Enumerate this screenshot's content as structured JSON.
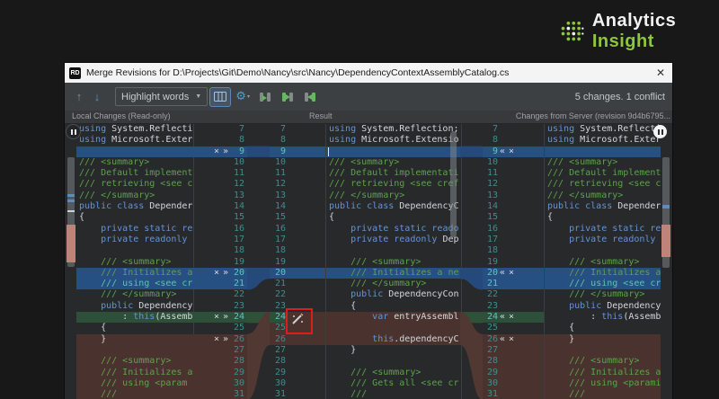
{
  "logo": {
    "brand_first": "Analytics ",
    "brand_second": "Insight"
  },
  "window": {
    "app_icon": "RD",
    "title": "Merge Revisions for D:\\Projects\\Git\\Demo\\Nancy\\src\\Nancy\\DependencyContextAssemblyCatalog.cs",
    "close_glyph": "✕"
  },
  "toolbar": {
    "prev_glyph": "↑",
    "next_glyph": "↓",
    "highlight_mode": "Highlight words",
    "caret_glyph": "▼",
    "gear_glyph": "⚙",
    "gear_caret_glyph": "▾",
    "status": "5 changes. 1 conflict"
  },
  "panes": {
    "headers": [
      "Local Changes (Read-only)",
      "Result",
      "Changes from Server (revision 9d4b6795..."
    ]
  },
  "colors": {
    "kw": "#6494d6",
    "cm": "#5ca349",
    "tx": "#d4d7da",
    "num": "#3e8e8e",
    "hlblue": "#264f82",
    "hlgreen": "#2e4f3a",
    "hlbrown": "#4a332e",
    "bandblue": "#24497a",
    "bandgreen": "#2f5138",
    "bandbrown": "#523832",
    "red": "#e01b1b",
    "logogreen": "#8dc63f",
    "editorbg": "#27292b"
  },
  "editor": {
    "left": {
      "read_only": true,
      "icon_glyphs": [
        "×",
        "»"
      ],
      "lines": [
        {
          "n": 7,
          "seg": [
            [
              "k",
              "using "
            ],
            [
              "t",
              "System.Reflecti"
            ]
          ]
        },
        {
          "n": 8,
          "seg": [
            [
              "k",
              "using "
            ],
            [
              "t",
              "Microsoft.Exter"
            ]
          ]
        },
        {
          "n": 9,
          "hl": "blue",
          "act": true,
          "seg": []
        },
        {
          "n": 10,
          "seg": [
            [
              "c",
              "/// <summary>"
            ]
          ]
        },
        {
          "n": 11,
          "seg": [
            [
              "c",
              "/// Default implement"
            ]
          ]
        },
        {
          "n": 12,
          "seg": [
            [
              "c",
              "/// retrieving <see c"
            ]
          ]
        },
        {
          "n": 13,
          "seg": [
            [
              "c",
              "/// </summary>"
            ]
          ]
        },
        {
          "n": 14,
          "seg": [
            [
              "k",
              "public class "
            ],
            [
              "t",
              "Depender"
            ]
          ]
        },
        {
          "n": 15,
          "seg": [
            [
              "t",
              "{"
            ]
          ]
        },
        {
          "n": 16,
          "seg": [
            [
              "t",
              "    "
            ],
            [
              "k",
              "private static re"
            ]
          ]
        },
        {
          "n": 17,
          "seg": [
            [
              "t",
              "    "
            ],
            [
              "k",
              "private readonly"
            ]
          ]
        },
        {
          "n": 18,
          "seg": []
        },
        {
          "n": 19,
          "seg": [
            [
              "t",
              "    "
            ],
            [
              "c",
              "/// <summary>"
            ]
          ]
        },
        {
          "n": 20,
          "hl": "blue",
          "act": true,
          "seg": [
            [
              "t",
              "    "
            ],
            [
              "c",
              "/// Initializes a"
            ]
          ]
        },
        {
          "n": 21,
          "hl": "blue",
          "seg": [
            [
              "t",
              "    "
            ],
            [
              "hc",
              "/// using <see cr"
            ]
          ]
        },
        {
          "n": 22,
          "seg": [
            [
              "t",
              "    "
            ],
            [
              "c",
              "/// </summary>"
            ]
          ]
        },
        {
          "n": 23,
          "seg": [
            [
              "t",
              "    "
            ],
            [
              "k",
              "public "
            ],
            [
              "t",
              "Dependency"
            ]
          ]
        },
        {
          "n": 24,
          "hl": "green",
          "act": true,
          "seg": [
            [
              "t",
              "        : "
            ],
            [
              "k",
              "this"
            ],
            [
              "t",
              "(Assemb"
            ]
          ]
        },
        {
          "n": 25,
          "seg": [
            [
              "t",
              "    {"
            ]
          ]
        },
        {
          "n": 26,
          "hl": "brown",
          "act": true,
          "seg": [
            [
              "t",
              "    }"
            ]
          ]
        },
        {
          "n": 27,
          "hl": "brown",
          "seg": []
        },
        {
          "n": 28,
          "hl": "brown",
          "seg": [
            [
              "t",
              "    "
            ],
            [
              "c",
              "/// <summary>"
            ]
          ]
        },
        {
          "n": 29,
          "hl": "brown",
          "seg": [
            [
              "t",
              "    "
            ],
            [
              "c",
              "/// Initializes a"
            ]
          ]
        },
        {
          "n": 30,
          "hl": "brown",
          "seg": [
            [
              "t",
              "    "
            ],
            [
              "c",
              "/// using <param"
            ]
          ]
        },
        {
          "n": 31,
          "hl": "brown",
          "seg": [
            [
              "t",
              "    "
            ],
            [
              "c",
              "///"
            ]
          ]
        }
      ]
    },
    "middle": {
      "read_only": false,
      "icon_glyphs": [],
      "lines": [
        {
          "n": 7,
          "seg": [
            [
              "k",
              "using "
            ],
            [
              "t",
              "System.Reflection;"
            ]
          ]
        },
        {
          "n": 8,
          "seg": [
            [
              "k",
              "using "
            ],
            [
              "t",
              "Microsoft.Extensio"
            ]
          ]
        },
        {
          "n": 9,
          "hl": "blue",
          "ghl": "blue",
          "whl": "blue",
          "cursor": true,
          "seg": []
        },
        {
          "n": 10,
          "seg": [
            [
              "c",
              "/// <summary>"
            ]
          ]
        },
        {
          "n": 11,
          "seg": [
            [
              "c",
              "/// Default implementati"
            ]
          ]
        },
        {
          "n": 12,
          "seg": [
            [
              "c",
              "/// retrieving <see cref"
            ]
          ]
        },
        {
          "n": 13,
          "seg": [
            [
              "c",
              "/// </summary>"
            ]
          ]
        },
        {
          "n": 14,
          "seg": [
            [
              "k",
              "public class "
            ],
            [
              "t",
              "DependencyC"
            ]
          ]
        },
        {
          "n": 15,
          "seg": [
            [
              "t",
              "{"
            ]
          ]
        },
        {
          "n": 16,
          "seg": [
            [
              "t",
              "    "
            ],
            [
              "k",
              "private static reado"
            ]
          ]
        },
        {
          "n": 17,
          "seg": [
            [
              "t",
              "    "
            ],
            [
              "k",
              "private readonly "
            ],
            [
              "t",
              "Dep"
            ]
          ]
        },
        {
          "n": 18,
          "seg": []
        },
        {
          "n": 19,
          "seg": [
            [
              "t",
              "    "
            ],
            [
              "c",
              "/// <summary>"
            ]
          ]
        },
        {
          "n": 20,
          "hl": "blue",
          "ghl": "blue",
          "whl": "blue",
          "seg": [
            [
              "t",
              "    "
            ],
            [
              "c",
              "/// Initializes a ne"
            ]
          ]
        },
        {
          "n": 21,
          "seg": [
            [
              "t",
              "    "
            ],
            [
              "c",
              "/// </summary>"
            ]
          ]
        },
        {
          "n": 22,
          "seg": [
            [
              "t",
              "    "
            ],
            [
              "k",
              "public "
            ],
            [
              "t",
              "DependencyCon"
            ]
          ]
        },
        {
          "n": 23,
          "seg": [
            [
              "t",
              "    {"
            ]
          ]
        },
        {
          "n": 24,
          "hl": "brown",
          "ghl": "green",
          "whl": "brown",
          "wand": true,
          "seg": [
            [
              "t",
              "        "
            ],
            [
              "k",
              "var"
            ],
            [
              "t",
              " entryAssembl"
            ]
          ]
        },
        {
          "n": 25,
          "hl": "brown",
          "ghl": "brown",
          "whl": "brown",
          "seg": []
        },
        {
          "n": 26,
          "hl": "brown",
          "ghl": "brown",
          "whl": "brown",
          "seg": [
            [
              "t",
              "        "
            ],
            [
              "k",
              "this"
            ],
            [
              "t",
              ".dependencyC"
            ]
          ]
        },
        {
          "n": 27,
          "seg": [
            [
              "t",
              "    }"
            ]
          ]
        },
        {
          "n": 28,
          "seg": []
        },
        {
          "n": 29,
          "seg": [
            [
              "t",
              "    "
            ],
            [
              "c",
              "/// <summary>"
            ]
          ]
        },
        {
          "n": 30,
          "seg": [
            [
              "t",
              "    "
            ],
            [
              "c",
              "/// Gets all <see cr"
            ]
          ]
        },
        {
          "n": 31,
          "seg": [
            [
              "t",
              "    "
            ],
            [
              "c",
              "///"
            ]
          ]
        }
      ]
    },
    "right": {
      "read_only": true,
      "icon_glyphs": [
        "«",
        "×"
      ],
      "lines": [
        {
          "n": 7,
          "seg": [
            [
              "k",
              "using "
            ],
            [
              "t",
              "System.Reflecti"
            ]
          ]
        },
        {
          "n": 8,
          "seg": [
            [
              "k",
              "using "
            ],
            [
              "t",
              "Microsoft.Exter"
            ]
          ]
        },
        {
          "n": 9,
          "hl": "blue",
          "act": true,
          "seg": []
        },
        {
          "n": 10,
          "seg": [
            [
              "c",
              "/// <summary>"
            ]
          ]
        },
        {
          "n": 11,
          "seg": [
            [
              "c",
              "/// Default implement"
            ]
          ]
        },
        {
          "n": 12,
          "seg": [
            [
              "c",
              "/// retrieving <see c"
            ]
          ]
        },
        {
          "n": 13,
          "seg": [
            [
              "c",
              "/// </summary>"
            ]
          ]
        },
        {
          "n": 14,
          "seg": [
            [
              "k",
              "public class "
            ],
            [
              "t",
              "Depender"
            ]
          ]
        },
        {
          "n": 15,
          "seg": [
            [
              "t",
              "{"
            ]
          ]
        },
        {
          "n": 16,
          "seg": [
            [
              "t",
              "    "
            ],
            [
              "k",
              "private static re"
            ]
          ]
        },
        {
          "n": 17,
          "seg": [
            [
              "t",
              "    "
            ],
            [
              "k",
              "private readonly"
            ]
          ]
        },
        {
          "n": 18,
          "seg": []
        },
        {
          "n": 19,
          "seg": [
            [
              "t",
              "    "
            ],
            [
              "c",
              "/// <summary>"
            ]
          ]
        },
        {
          "n": 20,
          "hl": "blue",
          "act": true,
          "seg": [
            [
              "t",
              "    "
            ],
            [
              "c",
              "/// Initializes a"
            ]
          ]
        },
        {
          "n": 21,
          "hl": "blue",
          "seg": [
            [
              "t",
              "    "
            ],
            [
              "hc",
              "/// using <see cr"
            ]
          ]
        },
        {
          "n": 22,
          "seg": [
            [
              "t",
              "    "
            ],
            [
              "c",
              "/// </summary>"
            ]
          ]
        },
        {
          "n": 23,
          "seg": [
            [
              "t",
              "    "
            ],
            [
              "k",
              "public "
            ],
            [
              "t",
              "Dependency"
            ]
          ]
        },
        {
          "n": 24,
          "ghl": "green",
          "act": true,
          "seg": [
            [
              "t",
              "        : "
            ],
            [
              "k",
              "this"
            ],
            [
              "t",
              "(Assemb"
            ]
          ]
        },
        {
          "n": 25,
          "seg": [
            [
              "t",
              "    {"
            ]
          ]
        },
        {
          "n": 26,
          "hl": "brown",
          "act": true,
          "seg": [
            [
              "t",
              "    }"
            ]
          ]
        },
        {
          "n": 27,
          "hl": "brown",
          "seg": []
        },
        {
          "n": 28,
          "hl": "brown",
          "seg": [
            [
              "t",
              "    "
            ],
            [
              "c",
              "/// <summary>"
            ]
          ]
        },
        {
          "n": 29,
          "hl": "brown",
          "seg": [
            [
              "t",
              "    "
            ],
            [
              "c",
              "/// Initializes a"
            ]
          ]
        },
        {
          "n": 30,
          "hl": "brown",
          "seg": [
            [
              "t",
              "    "
            ],
            [
              "c",
              "/// using <parami"
            ]
          ]
        },
        {
          "n": 31,
          "hl": "brown",
          "seg": [
            [
              "t",
              "    "
            ],
            [
              "c",
              "///"
            ]
          ]
        }
      ]
    }
  }
}
